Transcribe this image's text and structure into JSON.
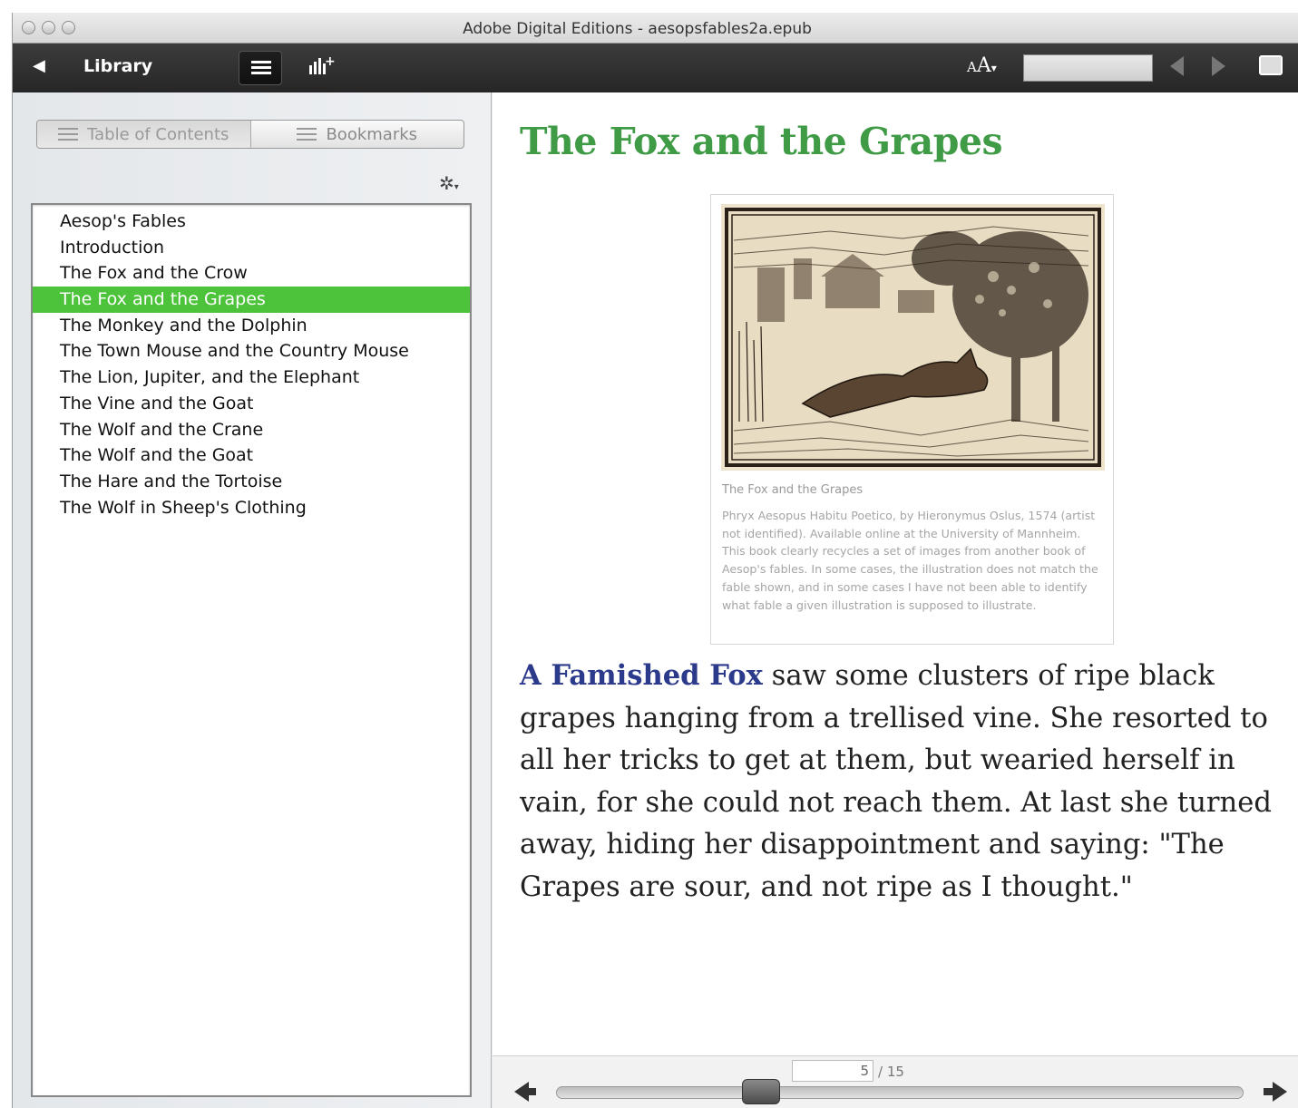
{
  "window": {
    "title": "Adobe Digital Editions - aesopsfables2a.epub"
  },
  "toolbar": {
    "library_label": "Library",
    "font_size_small": "A",
    "font_size_large": "A",
    "search_placeholder": ""
  },
  "sidebar": {
    "tabs": [
      {
        "label": "Table of Contents",
        "active": true
      },
      {
        "label": "Bookmarks",
        "active": false
      }
    ],
    "toc": [
      {
        "label": "Aesop's Fables"
      },
      {
        "label": "Introduction"
      },
      {
        "label": "The Fox and the Crow"
      },
      {
        "label": "The Fox and the Grapes",
        "selected": true
      },
      {
        "label": "The Monkey and the Dolphin"
      },
      {
        "label": "The Town Mouse and the Country Mouse"
      },
      {
        "label": "The Lion, Jupiter, and the Elephant"
      },
      {
        "label": "The Vine and the Goat"
      },
      {
        "label": "The Wolf and the Crane"
      },
      {
        "label": "The Wolf and the Goat"
      },
      {
        "label": "The Hare and the Tortoise"
      },
      {
        "label": "The Wolf in Sheep's Clothing"
      }
    ]
  },
  "reader": {
    "chapter_title": "The Fox and the Grapes",
    "figure": {
      "title": "The Fox and the Grapes",
      "caption": "Phryx Aesopus Habitu Poetico, by Hieronymus Oslus, 1574 (artist not identified). Available online at the University of Mannheim. This book clearly recycles a set of images from another book of Aesop's fables. In some cases, the illustration does not match the fable shown, and in some cases I have not been able to identify what fable a given illustration is supposed to illustrate."
    },
    "lead": "A Famished Fox",
    "body": " saw some clusters of ripe black grapes hanging from a trellised vine. She resorted to all her tricks to get at them, but wearied herself in vain, for she could not reach them. At last she turned away, hiding her disappointment and saying: \"The Grapes are sour, and not ripe as I thought.\""
  },
  "pagination": {
    "current_page": "5",
    "total_label": "/ 15",
    "current": 5,
    "total": 15
  },
  "colors": {
    "title_green": "#3f9b45",
    "selection_green": "#4dc23b",
    "lead_blue": "#2c3a8c"
  }
}
